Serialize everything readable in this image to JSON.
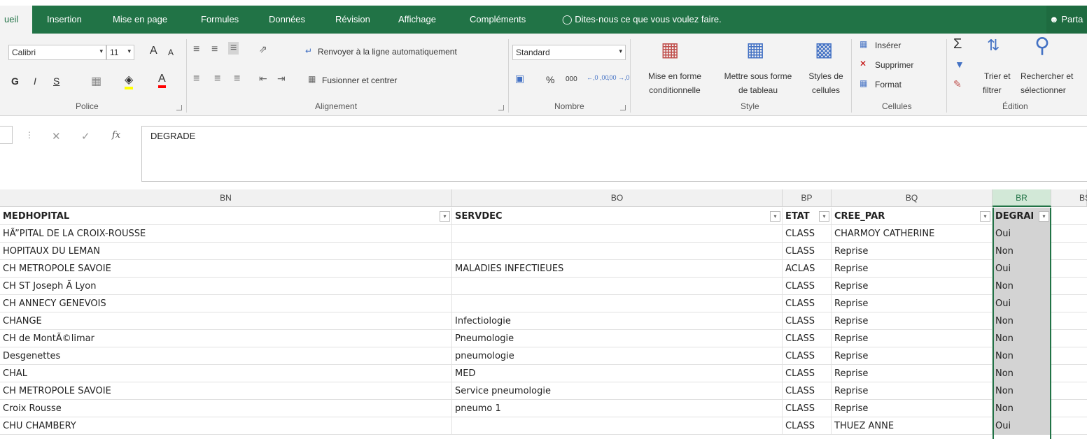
{
  "tabs": [
    "ueil",
    "Insertion",
    "Mise en page",
    "Formules",
    "Données",
    "Révision",
    "Affichage",
    "Compléments"
  ],
  "tell_me": "Dites-nous ce que vous voulez faire.",
  "share": "Parta",
  "ribbon": {
    "font_name": "Calibri",
    "font_size": "11",
    "grow_font": "A",
    "shrink_font": "A",
    "bold": "G",
    "italic": "I",
    "underline": "S",
    "font_color": "A",
    "wrap_text": "Renvoyer à la ligne automatiquement",
    "merge_center": "Fusionner et centrer",
    "number_format": "Standard",
    "percent": "%",
    "thousands": "000",
    "inc_decimal": "←,0 ,00",
    "dec_decimal": ",00 →,0",
    "cond_format_1": "Mise en forme",
    "cond_format_2": "conditionnelle",
    "format_table_1": "Mettre sous forme",
    "format_table_2": "de tableau",
    "cell_styles_1": "Styles de",
    "cell_styles_2": "cellules",
    "insert": "Insérer",
    "delete": "Supprimer",
    "format": "Format",
    "sort_1": "Trier et",
    "sort_2": "filtrer",
    "find_1": "Rechercher et",
    "find_2": "sélectionner",
    "groups": {
      "police": "Police",
      "alignement": "Alignement",
      "nombre": "Nombre",
      "style": "Style",
      "cellules": "Cellules",
      "edition": "Édition"
    }
  },
  "formula_bar": {
    "content": "DEGRADE",
    "fx": "fx"
  },
  "columns": [
    "BN",
    "BO",
    "BP",
    "BQ",
    "BR",
    "BS"
  ],
  "header_row": [
    "MEDHOPITAL",
    "SERVDEC",
    "ETAT",
    "CREE_PAR",
    "DEGRAI"
  ],
  "rows": [
    [
      "HÃ”PITAL DE LA CROIX-ROUSSE",
      "",
      "CLASS",
      "CHARMOY CATHERINE",
      "Oui"
    ],
    [
      "HOPITAUX DU LEMAN",
      "",
      "CLASS",
      "Reprise",
      "Non"
    ],
    [
      "CH METROPOLE SAVOIE",
      "MALADIES INFECTIEUES",
      "ACLAS",
      "Reprise",
      "Oui"
    ],
    [
      "CH ST Joseph Ã  Lyon",
      "",
      "CLASS",
      "Reprise",
      "Non"
    ],
    [
      "CH ANNECY GENEVOIS",
      "",
      "CLASS",
      "Reprise",
      "Oui"
    ],
    [
      "CHANGE",
      "Infectiologie",
      "CLASS",
      "Reprise",
      "Non"
    ],
    [
      "CH de MontÃ©limar",
      "Pneumologie",
      "CLASS",
      "Reprise",
      "Non"
    ],
    [
      "Desgenettes",
      "pneumologie",
      "CLASS",
      "Reprise",
      "Non"
    ],
    [
      "CHAL",
      "MED",
      "CLASS",
      "Reprise",
      "Non"
    ],
    [
      "CH METROPOLE SAVOIE",
      "Service pneumologie",
      "CLASS",
      "Reprise",
      "Non"
    ],
    [
      "Croix Rousse",
      "pneumo 1",
      "CLASS",
      "Reprise",
      "Non"
    ],
    [
      "CHU CHAMBERY",
      "",
      "CLASS",
      "THUEZ ANNE",
      "Oui"
    ]
  ],
  "colors": {
    "accent": "#217346",
    "selected_col": "#d2e8d7"
  }
}
